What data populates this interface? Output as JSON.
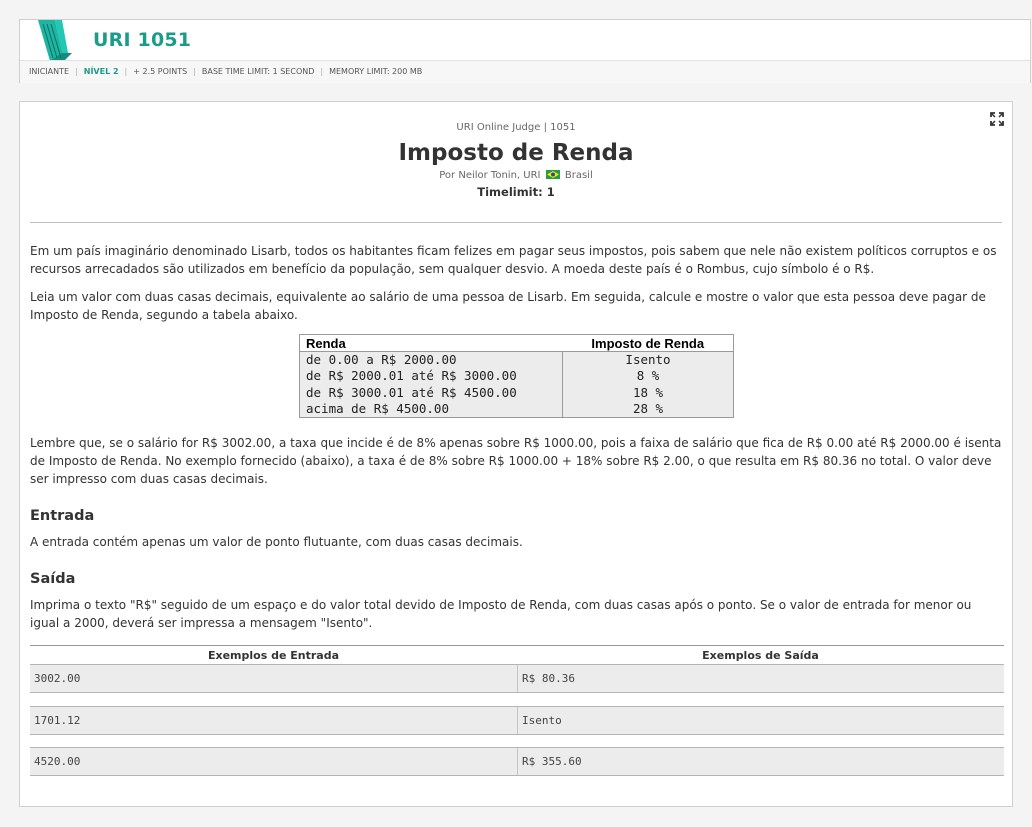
{
  "header": {
    "problem_title": "URI 1051",
    "meta": {
      "category": "INICIANTE",
      "level": "NÍVEL 2",
      "points": "+ 2.5 POINTS",
      "time_limit": "BASE TIME LIMIT: 1 SECOND",
      "memory_limit": "MEMORY LIMIT: 200 MB"
    }
  },
  "problem": {
    "judge_line": "URI Online Judge | 1051",
    "title": "Imposto de Renda",
    "author_prefix": "Por Neilor Tonin, URI",
    "author_country": "Brasil",
    "timelimit": "Timelimit: 1",
    "paragraph1": "Em um país imaginário denominado Lisarb, todos os habitantes ficam felizes em pagar seus impostos, pois sabem que nele não existem políticos corruptos e os recursos arrecadados são utilizados em benefício da população, sem qualquer desvio. A moeda deste país é o Rombus, cujo símbolo é o R$.",
    "paragraph2": "Leia um valor com duas casas decimais, equivalente ao salário de uma pessoa de Lisarb. Em seguida, calcule e mostre o valor que esta pessoa deve pagar de Imposto de Renda, segundo a tabela abaixo.",
    "tax_table": {
      "headers": [
        "Renda",
        "Imposto de Renda"
      ],
      "rows": [
        [
          "de 0.00 a R$ 2000.00",
          "Isento"
        ],
        [
          "de R$ 2000.01 até R$ 3000.00",
          "8 %"
        ],
        [
          "de R$ 3000.01 até R$ 4500.00",
          "18 %"
        ],
        [
          "acima de R$ 4500.00",
          "28 %"
        ]
      ]
    },
    "paragraph3": "Lembre que, se o salário for R$ 3002.00, a taxa que incide é de 8% apenas sobre R$ 1000.00, pois a faixa de salário que fica de R$ 0.00 até R$ 2000.00 é isenta de Imposto de Renda. No exemplo fornecido (abaixo), a taxa é de 8% sobre R$ 1000.00 + 18% sobre R$ 2.00, o que resulta em R$ 80.36 no total. O valor deve ser impresso com duas casas decimais.",
    "entrada_title": "Entrada",
    "entrada_text": "A entrada contém apenas um valor de ponto flutuante, com duas casas decimais.",
    "saida_title": "Saída",
    "saida_text": "Imprima o texto \"R$\" seguido de um espaço e do valor total devido de Imposto de Renda, com duas casas após o ponto. Se o valor de entrada for menor ou igual a 2000, deverá ser impressa a mensagem \"Isento\"."
  },
  "examples": {
    "input_header": "Exemplos de Entrada",
    "output_header": "Exemplos de Saída",
    "rows": [
      {
        "input": "3002.00",
        "output": "R$ 80.36"
      },
      {
        "input": "1701.12",
        "output": "Isento"
      },
      {
        "input": "4520.00",
        "output": "R$ 355.60"
      }
    ]
  },
  "colors": {
    "accent": "#1a9c8b",
    "row_background": "#ececec"
  }
}
